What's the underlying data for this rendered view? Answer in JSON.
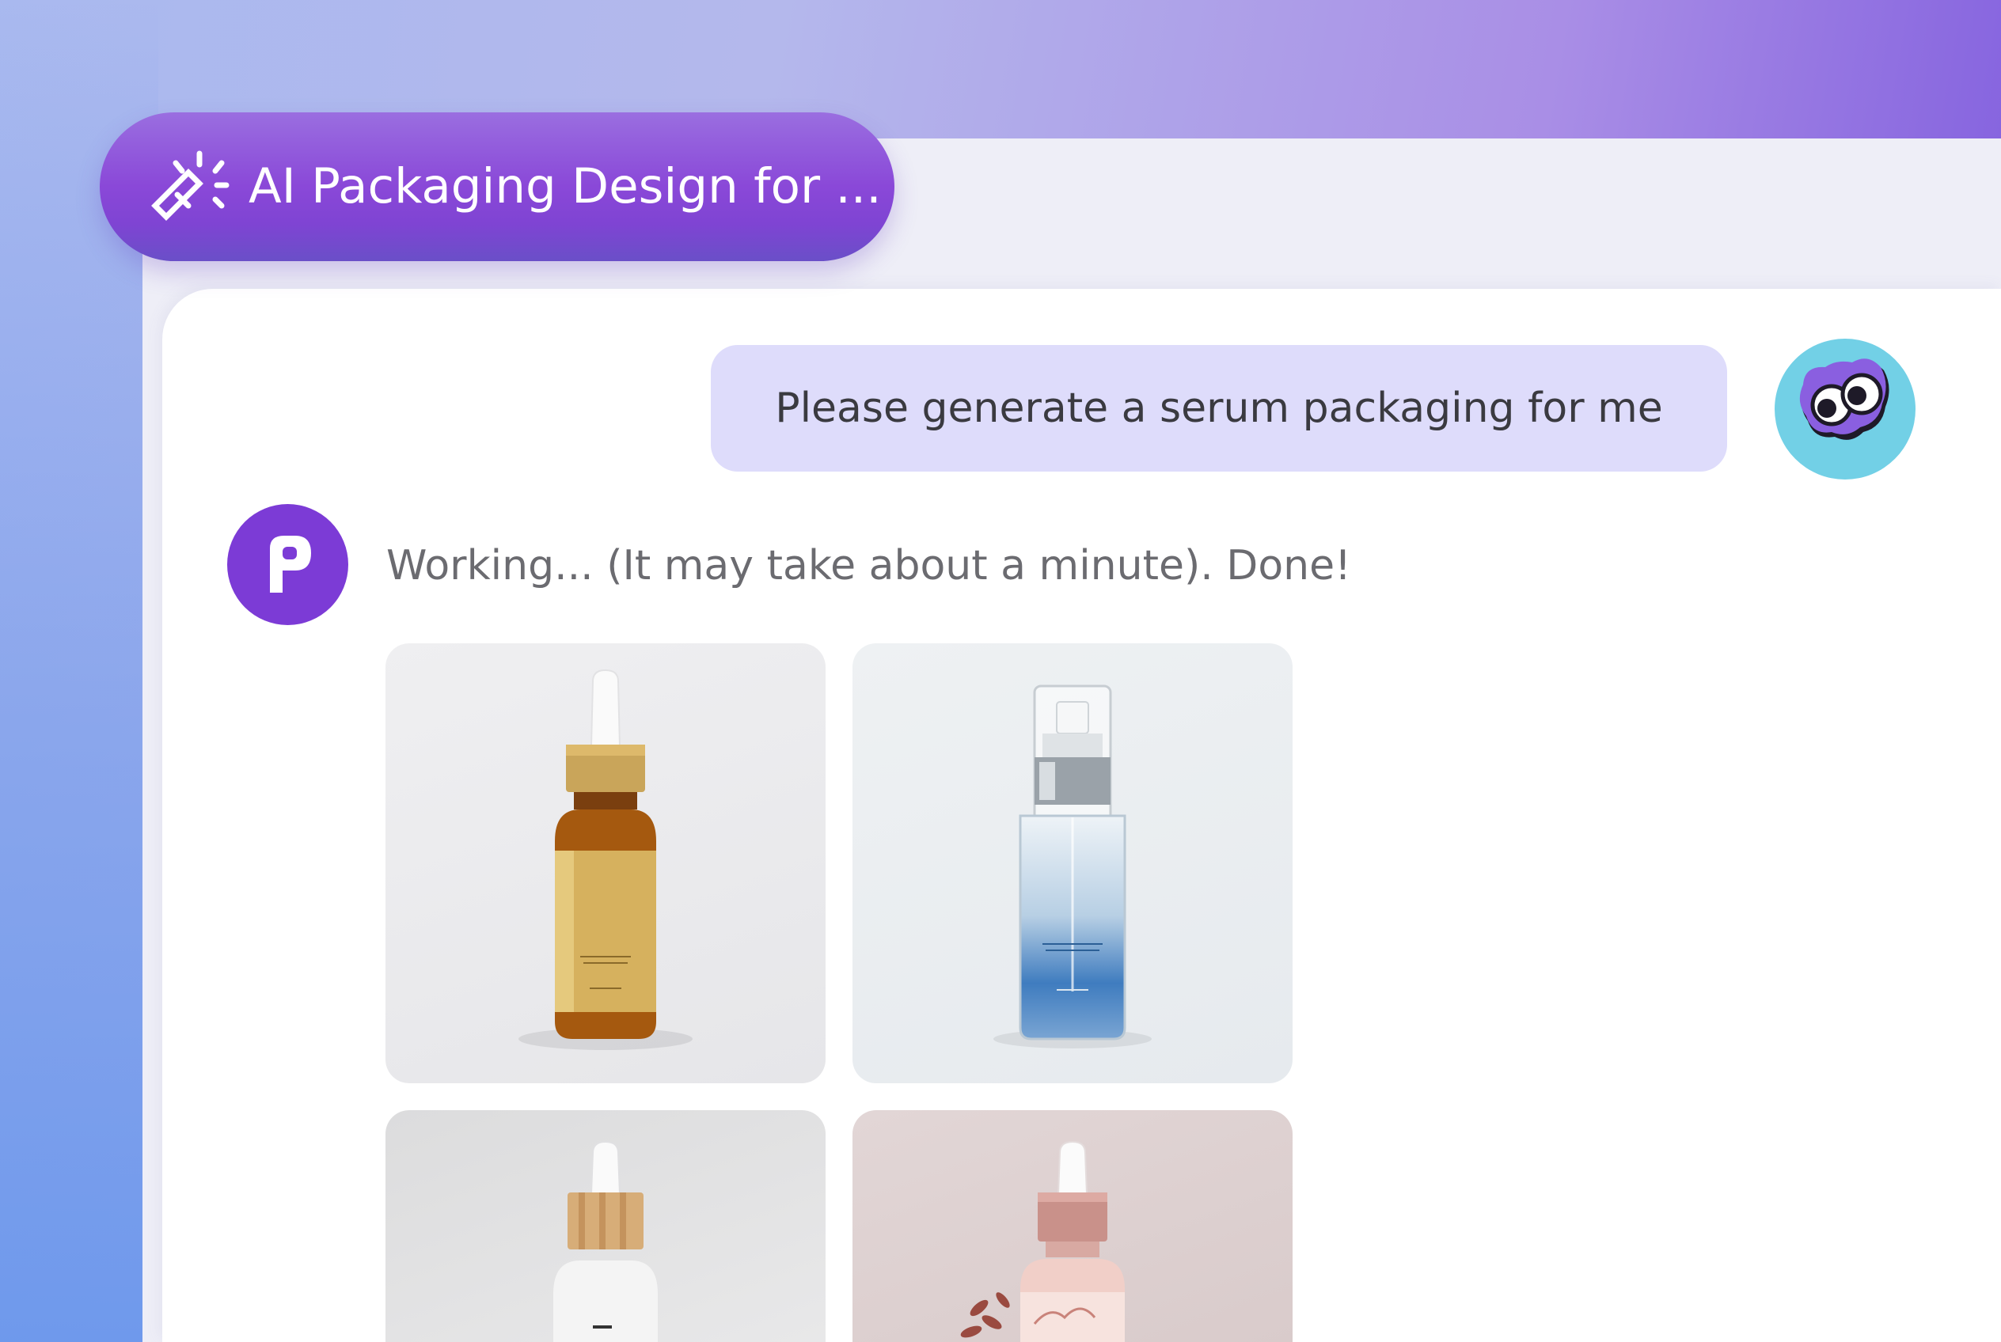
{
  "header": {
    "title": "AI Packaging Design for ...",
    "icon": "magic-wand-icon"
  },
  "chat": {
    "user_message": "Please generate a serum packaging for me",
    "bot_status": "Working... (It may take about a minute). Done!",
    "bot_avatar_letter": "p"
  },
  "results": {
    "images": [
      {
        "name": "amber-dropper-bottle-gold-label"
      },
      {
        "name": "clear-blue-pump-bottle"
      },
      {
        "name": "white-dropper-bottle-wood-cap"
      },
      {
        "name": "pink-dropper-bottle-floral"
      }
    ]
  },
  "colors": {
    "accent": "#7c3bd6",
    "user_bubble": "#dedcfb",
    "user_avatar": "#72d0e6"
  }
}
